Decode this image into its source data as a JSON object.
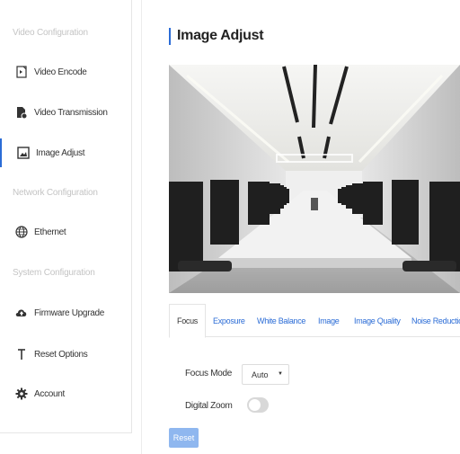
{
  "sidebar": {
    "sections": [
      {
        "header": "Video Configuration",
        "items": [
          {
            "label": "Video Encode",
            "icon": "video-encode-icon"
          },
          {
            "label": "Video Transmission",
            "icon": "video-transmission-icon"
          },
          {
            "label": "Image Adjust",
            "icon": "image-adjust-icon",
            "active": true
          }
        ]
      },
      {
        "header": "Network Configuration",
        "items": [
          {
            "label": "Ethernet",
            "icon": "globe-icon"
          }
        ]
      },
      {
        "header": "System Configuration",
        "items": [
          {
            "label": "Firmware Upgrade",
            "icon": "cloud-upload-icon"
          },
          {
            "label": "Reset Options",
            "icon": "reset-icon"
          },
          {
            "label": "Account",
            "icon": "gear-icon"
          }
        ]
      }
    ]
  },
  "main": {
    "title": "Image Adjust",
    "tabs": [
      {
        "label": "Focus",
        "active": true
      },
      {
        "label": "Exposure"
      },
      {
        "label": "White Balance"
      },
      {
        "label": "Image"
      },
      {
        "label": "Image Quality"
      },
      {
        "label": "Noise Reduction"
      }
    ],
    "form": {
      "focus_mode_label": "Focus Mode",
      "focus_mode_value": "Auto",
      "digital_zoom_label": "Digital Zoom",
      "digital_zoom_on": false
    },
    "reset_label": "Reset"
  },
  "colors": {
    "accent": "#2b6cd6",
    "reset_button": "#8fb7ef",
    "section_header": "#c4c4c4"
  }
}
